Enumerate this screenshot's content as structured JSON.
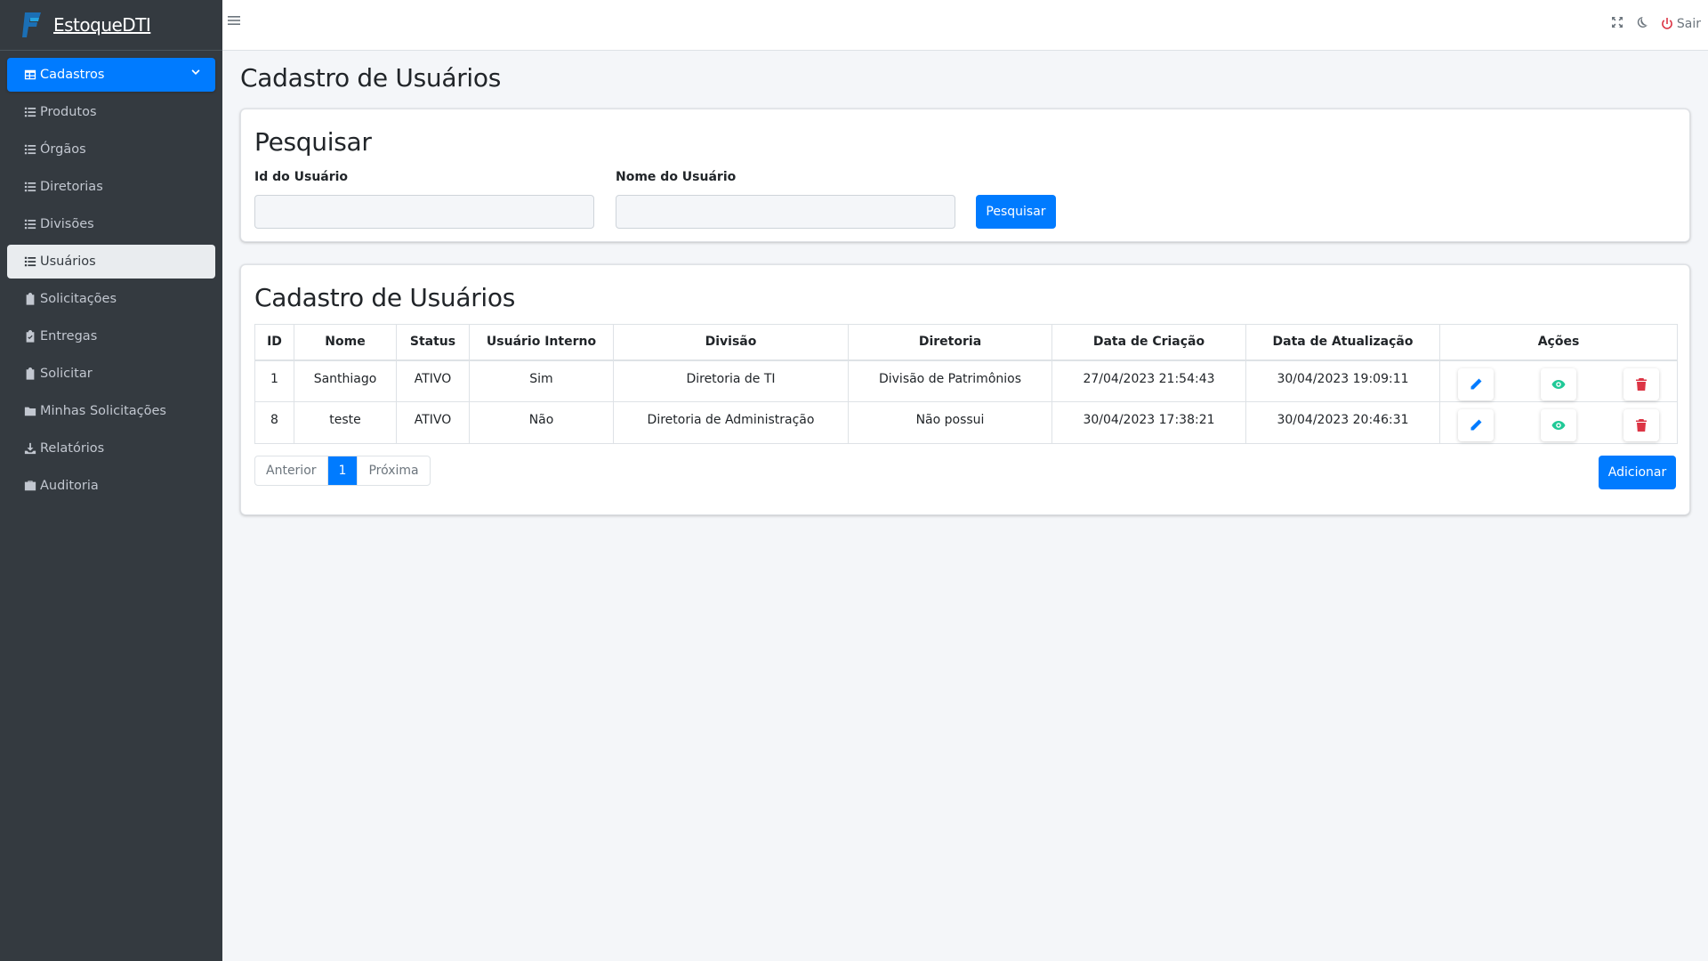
{
  "brand": {
    "name": "EstoqueDTI"
  },
  "sidebar": {
    "items": [
      {
        "label": "Cadastros",
        "icon": "table-icon"
      },
      {
        "label": "Produtos",
        "icon": "list-icon"
      },
      {
        "label": "Órgãos",
        "icon": "list-icon"
      },
      {
        "label": "Diretorias",
        "icon": "list-icon"
      },
      {
        "label": "Divisões",
        "icon": "list-icon"
      },
      {
        "label": "Usuários",
        "icon": "list-icon"
      },
      {
        "label": "Solicitações",
        "icon": "clipboard-icon"
      },
      {
        "label": "Entregas",
        "icon": "clipboard-check-icon"
      },
      {
        "label": "Solicitar",
        "icon": "clipboard-icon"
      },
      {
        "label": "Minhas Solicitações",
        "icon": "folder-icon"
      },
      {
        "label": "Relatórios",
        "icon": "download-icon"
      },
      {
        "label": "Auditoria",
        "icon": "briefcase-icon"
      }
    ]
  },
  "topbar": {
    "logout_label": "Sair"
  },
  "page": {
    "title": "Cadastro de Usuários"
  },
  "search": {
    "title": "Pesquisar",
    "id_label": "Id do Usuário",
    "id_value": "",
    "name_label": "Nome do Usuário",
    "name_value": "",
    "button_label": "Pesquisar"
  },
  "table_card": {
    "title": "Cadastro de Usuários",
    "columns": [
      "ID",
      "Nome",
      "Status",
      "Usuário Interno",
      "Divisão",
      "Diretoria",
      "Data de Criação",
      "Data de Atualização",
      "Ações"
    ],
    "rows": [
      [
        "1",
        "Santhiago",
        "ATIVO",
        "Sim",
        "Diretoria de TI",
        "Divisão de Patrimônios",
        "27/04/2023 21:54:43",
        "30/04/2023 19:09:11"
      ],
      [
        "8",
        "teste",
        "ATIVO",
        "Não",
        "Diretoria de Administração",
        "Não possui",
        "30/04/2023 17:38:21",
        "30/04/2023 20:46:31"
      ]
    ],
    "pagination": {
      "prev": "Anterior",
      "current": "1",
      "next": "Próxima"
    },
    "add_label": "Adicionar"
  },
  "colors": {
    "primary": "#007bff",
    "sidebar": "#343a40",
    "edit": "#007bff",
    "view": "#20c997",
    "delete": "#dc3545"
  }
}
